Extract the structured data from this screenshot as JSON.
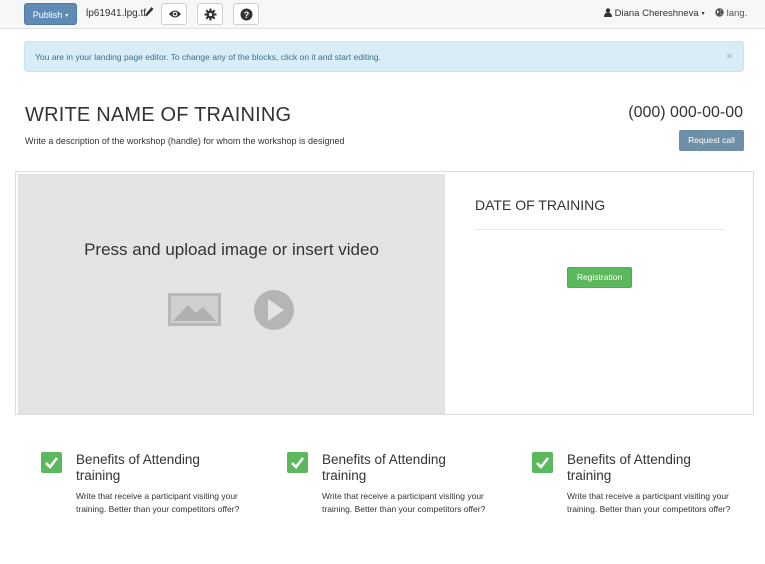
{
  "toolbar": {
    "publish_label": "Publish",
    "caret": "▾",
    "filename": "lp61941.lpg.tf",
    "user_name": "Diana Chereshneva",
    "lang_label": "lang."
  },
  "alert": {
    "text": "You are in your landing page editor. To change any of the blocks, click on it and start editing.",
    "close": "×"
  },
  "header": {
    "title": "WRITE NAME OF TRAINING",
    "subtitle": "Write a description of the workshop (handle) for whom the workshop is designed",
    "phone": "(000) 000-00-00",
    "request_call": "Request call"
  },
  "main": {
    "media_text": "Press and upload image or insert video",
    "date_title": "DATE OF TRAINING",
    "registration": "Registration"
  },
  "benefits": [
    {
      "title": "Benefits of Attending training",
      "text": "Write that receive a participant visiting your training. Better than your competitors offer?"
    },
    {
      "title": "Benefits of Attending training",
      "text": "Write that receive a participant visiting your training. Better than your competitors offer?"
    },
    {
      "title": "Benefits of Attending training",
      "text": "Write that receive a participant visiting your training. Better than your competitors offer?"
    }
  ],
  "colors": {
    "publish": "#5f8bb4",
    "alert_bg": "#d9edf7",
    "request_call": "#6d8fa8",
    "registration": "#5cb85c",
    "check": "#5cb85c"
  },
  "icons": [
    "pencil-icon",
    "eye-icon",
    "gear-icon",
    "question-icon",
    "user-icon",
    "globe-icon",
    "image-icon",
    "play-icon",
    "check-icon"
  ]
}
